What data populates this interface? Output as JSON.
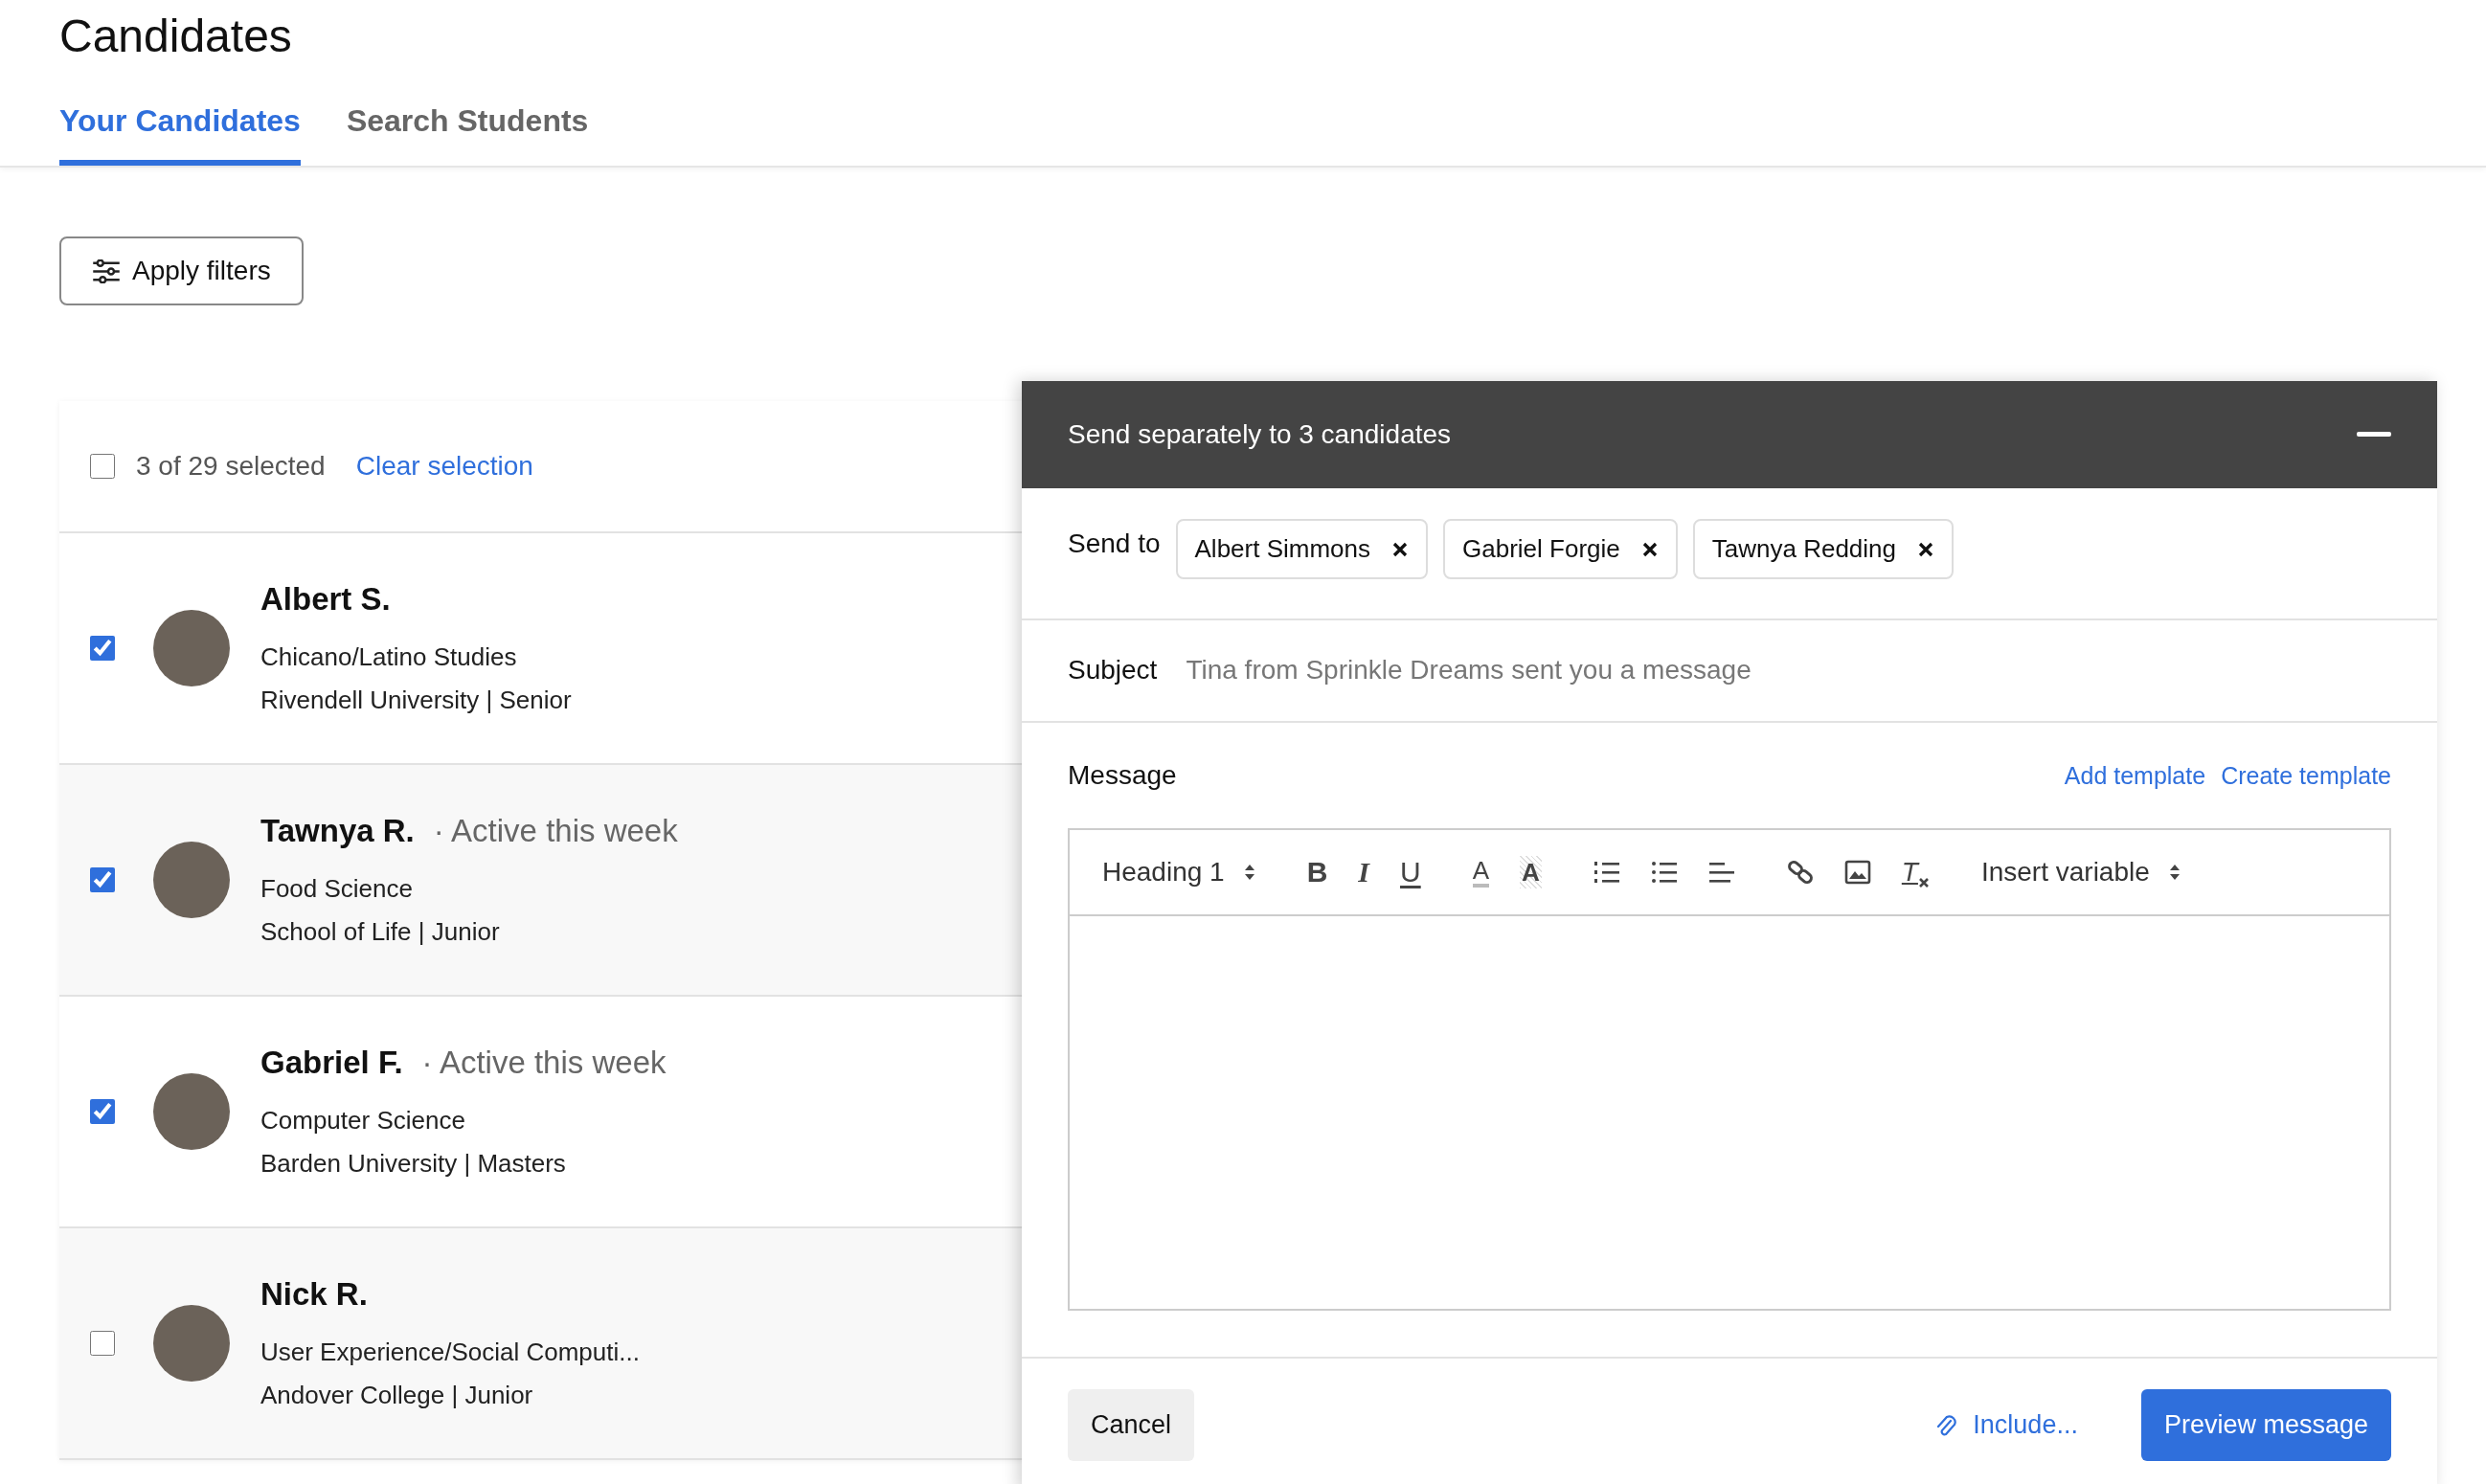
{
  "page": {
    "title": "Candidates"
  },
  "tabs": [
    {
      "label": "Your Candidates",
      "selected": true
    },
    {
      "label": "Search Students",
      "selected": false
    }
  ],
  "filters_button": {
    "label": "Apply filters"
  },
  "selection": {
    "checked": false,
    "count": "3 of 29 selected",
    "clear_link": "Clear selection"
  },
  "candidates": [
    {
      "name": "Albert S.",
      "major": "Chicano/Latino Studies",
      "school": "Rivendell University | Senior",
      "checked": true
    },
    {
      "name": "Tawnya R.",
      "activity": "· Active this week",
      "major": "Food Science",
      "school": "School of Life | Junior",
      "checked": true
    },
    {
      "name": "Gabriel F.",
      "activity": "· Active this week",
      "major": "Computer Science",
      "school": "Barden University | Masters",
      "checked": true
    },
    {
      "name": "Nick R.",
      "major": "User Experience/Social Computi...",
      "school": "Andover College | Junior",
      "checked": false
    }
  ],
  "compose": {
    "title": "Send separately to 3 candidates",
    "send_to_label": "Send to",
    "recipients": [
      "Albert Simmons",
      "Gabriel Forgie",
      "Tawnya Redding"
    ],
    "subject_label": "Subject",
    "subject_placeholder": "Tina from Sprinkle Dreams sent you a message",
    "message_label": "Message",
    "template_links": [
      "Add template",
      "Create template"
    ],
    "toolbar": [
      {
        "items": [
          {
            "kind": "select",
            "label": "Heading 1"
          }
        ]
      },
      {
        "items": [
          {
            "kind": "bold",
            "label": "B"
          },
          {
            "kind": "italic",
            "label": "I"
          },
          {
            "kind": "underline",
            "label": "U"
          }
        ]
      },
      {
        "items": [
          {
            "kind": "text-color",
            "label": "A"
          },
          {
            "kind": "highlight",
            "label": "A"
          }
        ]
      },
      {
        "items": [
          {
            "kind": "ordered-list"
          },
          {
            "kind": "bullet-list"
          },
          {
            "kind": "align"
          }
        ]
      },
      {
        "items": [
          {
            "kind": "link"
          },
          {
            "kind": "image"
          },
          {
            "kind": "clear-format",
            "label": "T"
          }
        ]
      },
      {
        "items": [
          {
            "kind": "select",
            "label": "Insert variable"
          }
        ]
      }
    ],
    "cancel": "Cancel",
    "include": "Include...",
    "preview": "Preview message"
  }
}
